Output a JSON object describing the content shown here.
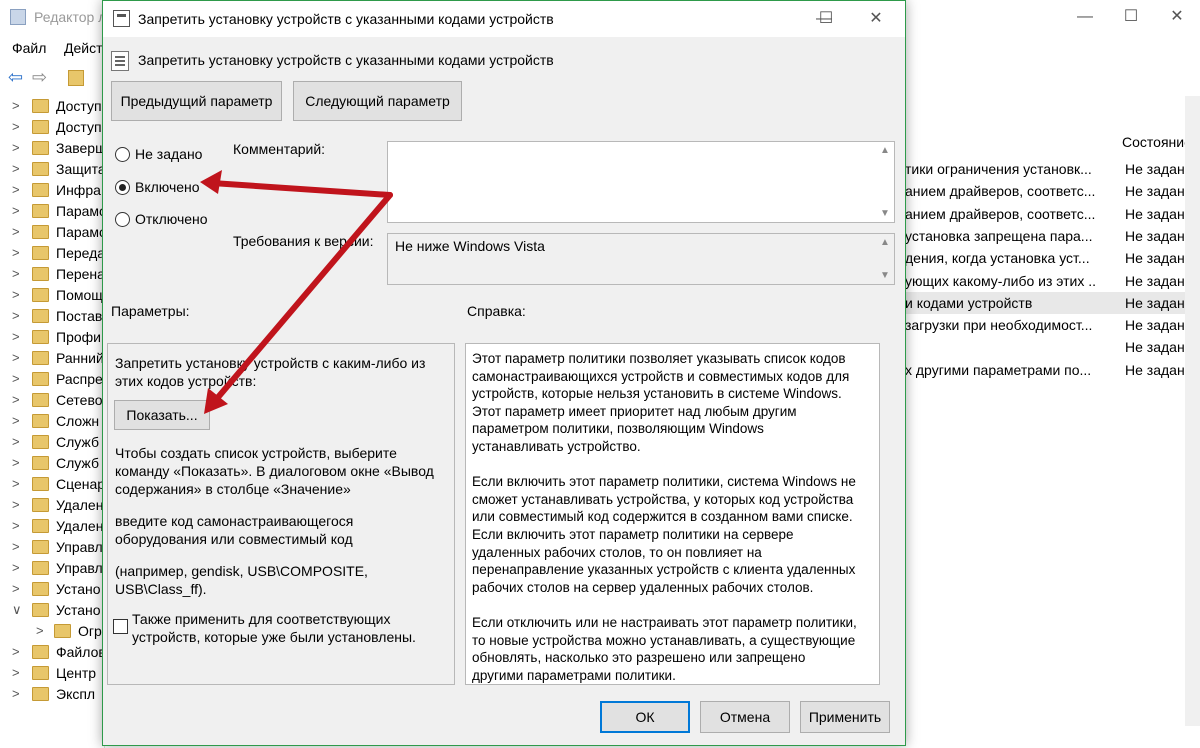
{
  "background_window": {
    "title": "Редактор л",
    "menu": [
      "Файл",
      "Действ"
    ],
    "tree_items": [
      "Доступ",
      "Доступ",
      "Заверш",
      "Защита",
      "Инфра",
      "Парамс",
      "Парамс",
      "Переда",
      "Перена",
      "Помощ",
      "Постав",
      "Профи",
      "Ранний",
      "Распре",
      "Сетево",
      "Сложн",
      "Служб",
      "Служб",
      "Сценар",
      "Удален",
      "Удален",
      "Управл",
      "Управл",
      "Устано",
      "Устано",
      "Огр",
      "Файлов",
      "Центр",
      "Экспл"
    ],
    "column_header_state": "Состояние",
    "rows": [
      {
        "desc": "тики ограничения установк...",
        "state": "Не задана"
      },
      {
        "desc": "анием драйверов, соответс...",
        "state": "Не задана"
      },
      {
        "desc": "анием драйверов, соответс...",
        "state": "Не задана"
      },
      {
        "desc": "установка запрещена пара...",
        "state": "Не задана"
      },
      {
        "desc": "дения, когда установка уст...",
        "state": "Не задана"
      },
      {
        "desc": "ующих какому-либо из этих ...",
        "state": "Не задана"
      },
      {
        "desc": "и кодами устройств",
        "state": "Не задана"
      },
      {
        "desc": "загрузки при необходимост...",
        "state": "Не задана"
      },
      {
        "desc": "",
        "state": "Не задана"
      },
      {
        "desc": "х другими параметрами по...",
        "state": "Не задана"
      }
    ]
  },
  "dialog": {
    "title": "Запретить установку устройств с указанными кодами устройств",
    "header": "Запретить установку устройств с указанными кодами устройств",
    "prev_button": "Предыдущий параметр",
    "next_button": "Следующий параметр",
    "radio_not_set": "Не задано",
    "radio_enabled": "Включено",
    "radio_disabled": "Отключено",
    "comment_label": "Комментарий:",
    "requirements_label": "Требования к версии:",
    "requirements_value": "Не ниже Windows Vista",
    "params_label": "Параметры:",
    "help_label": "Справка:",
    "params": {
      "intro_1": "Запретить установку устройств с каким-либо из",
      "intro_2": "этих кодов устройств:",
      "show_button": "Показать...",
      "p1_1": "Чтобы создать список устройств, выберите",
      "p1_2": "команду «Показать». В диалоговом окне «Вывод",
      "p1_3": "содержания» в столбце «Значение»",
      "p2_1": "введите код самонастраивающегося",
      "p2_2": "оборудования или совместимый код",
      "p3_1": "(например, gendisk, USB\\COMPOSITE,",
      "p3_2": "USB\\Class_ff).",
      "checkbox_1": "Также применить для соответствующих",
      "checkbox_2": "устройств, которые уже были установлены."
    },
    "help_lines": [
      "Этот параметр политики позволяет указывать список кодов",
      "самонастраивающихся устройств и совместимых кодов для",
      "устройств, которые нельзя установить в системе Windows.",
      "Этот параметр имеет приоритет над любым другим",
      "параметром политики, позволяющим Windows",
      "устанавливать устройство.",
      "",
      "Если включить этот параметр политики, система Windows не",
      "сможет устанавливать устройства, у которых код устройства",
      "или совместимый код содержится в созданном вами списке.",
      "Если включить этот параметр политики на сервере",
      "удаленных рабочих столов, то он повлияет на",
      "перенаправление указанных устройств с клиента удаленных",
      "рабочих столов на сервер удаленных рабочих столов.",
      "",
      "Если отключить или не настраивать этот параметр политики,",
      "то новые устройства можно устанавливать, а существующие",
      "обновлять, насколько это разрешено или запрещено",
      "другими параметрами политики."
    ],
    "ok": "ОК",
    "cancel": "Отмена",
    "apply": "Применить"
  },
  "colors": {
    "accent_border": "#2e9a4a",
    "arrow": "#c0141c",
    "ok_border": "#0078d7"
  }
}
